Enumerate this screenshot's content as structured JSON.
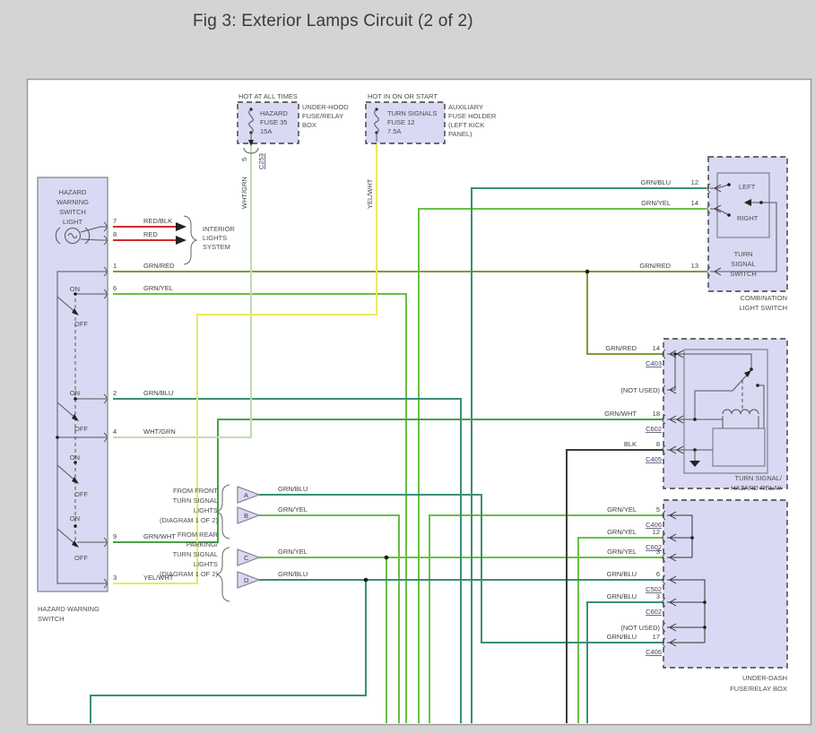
{
  "title": "Fig 3: Exterior Lamps Circuit (2 of 2)",
  "colors": {
    "lavender": "#d9d9f3",
    "grn_red": "#7d9b3a",
    "grn_yel": "#68c046",
    "grn_blu": "#3b8e79",
    "grn_wht": "#44a348",
    "wht_grn": "#bedcb0",
    "yel_wht": "#eae95c",
    "red": "#cf2b2b",
    "blk": "#3c3c3c"
  },
  "fuse_box_underhood": {
    "hot_label": "HOT AT ALL TIMES",
    "fuse_line1": "HAZARD",
    "fuse_line2": "FUSE 35",
    "fuse_line3": "15A",
    "box_line1": "UNDER-HOOD",
    "box_line2": "FUSE/RELAY",
    "box_line3": "BOX",
    "pin": "5",
    "connector": "C253",
    "wire": "WHT/GRN"
  },
  "fuse_box_aux": {
    "hot_label": "HOT IN ON OR START",
    "fuse_line1": "TURN SIGNALS",
    "fuse_line2": "FUSE 12",
    "fuse_line3": "7.5A",
    "box_line1": "AUXILIARY",
    "box_line2": "FUSE HOLDER",
    "box_line3": "(LEFT KICK",
    "box_line4": "PANEL)",
    "wire": "YEL/WHT"
  },
  "hazard_switch": {
    "title_line1": "HAZARD",
    "title_line2": "WARNING",
    "title_line3": "SWITCH",
    "title_line4": "LIGHT",
    "caption_line1": "HAZARD WARNING",
    "caption_line2": "SWITCH",
    "on": "ON",
    "off": "OFF",
    "pins": [
      {
        "pin": "7",
        "wire": "RED/BLK"
      },
      {
        "pin": "8",
        "wire": "RED"
      },
      {
        "pin": "1",
        "wire": "GRN/RED"
      },
      {
        "pin": "6",
        "wire": "GRN/YEL"
      },
      {
        "pin": "2",
        "wire": "GRN/BLU"
      },
      {
        "pin": "4",
        "wire": "WHT/GRN"
      },
      {
        "pin": "9",
        "wire": "GRN/WHT"
      },
      {
        "pin": "3",
        "wire": "YEL/WHT"
      }
    ]
  },
  "interior_lights": {
    "line1": "INTERIOR",
    "line2": "LIGHTS",
    "line3": "SYSTEM"
  },
  "combination_switch": {
    "left": "LEFT",
    "right": "RIGHT",
    "name_line1": "TURN",
    "name_line2": "SIGNAL",
    "name_line3": "SWITCH",
    "caption_line1": "COMBINATION",
    "caption_line2": "LIGHT SWITCH",
    "pins": [
      {
        "wire": "GRN/BLU",
        "pin": "12"
      },
      {
        "wire": "GRN/YEL",
        "pin": "14"
      },
      {
        "wire": "GRN/RED",
        "pin": "13"
      }
    ]
  },
  "relay": {
    "caption_line1": "TURN SIGNAL/",
    "caption_line2": "HAZARD RELAY",
    "pins": [
      {
        "wire": "GRN/RED",
        "pin": "14",
        "connector": "C403"
      },
      {
        "not_used": "(NOT USED)"
      },
      {
        "wire": "GRN/WHT",
        "pin": "18",
        "connector": "C602"
      },
      {
        "wire": "BLK",
        "pin": "8",
        "connector": "C405"
      }
    ]
  },
  "underdash_box": {
    "caption_line1": "UNDER-DASH",
    "caption_line2": "FUSE/RELAY BOX",
    "pins": [
      {
        "wire": "GRN/YEL",
        "pin": "5",
        "connector": "C406"
      },
      {
        "wire": "GRN/YEL",
        "pin": "12",
        "connector": "C602"
      },
      {
        "wire": "GRN/YEL",
        "pin": "3"
      },
      {
        "wire": "GRN/BLU",
        "pin": "6",
        "connector": "C502"
      },
      {
        "wire": "GRN/BLU",
        "pin": "3",
        "connector": "C602"
      },
      {
        "not_used": "(NOT USED)"
      },
      {
        "wire": "GRN/BLU",
        "pin": "17",
        "connector": "C406"
      }
    ]
  },
  "from_front": {
    "line1": "FROM FRONT",
    "line2": "TURN SIGNAL",
    "line3": "LIGHTS",
    "line4": "(DIAGRAM 1 OF 2)",
    "connectors": [
      {
        "id": "A",
        "wire": "GRN/BLU"
      },
      {
        "id": "B",
        "wire": "GRN/YEL"
      }
    ]
  },
  "from_rear": {
    "line1": "FROM REAR",
    "line2": "PARKING/",
    "line3": "TURN SIGNAL",
    "line4": "LIGHTS",
    "line5": "(DIAGRAM 1 OF 2)",
    "connectors": [
      {
        "id": "C",
        "wire": "GRN/YEL"
      },
      {
        "id": "D",
        "wire": "GRN/BLU"
      }
    ]
  }
}
